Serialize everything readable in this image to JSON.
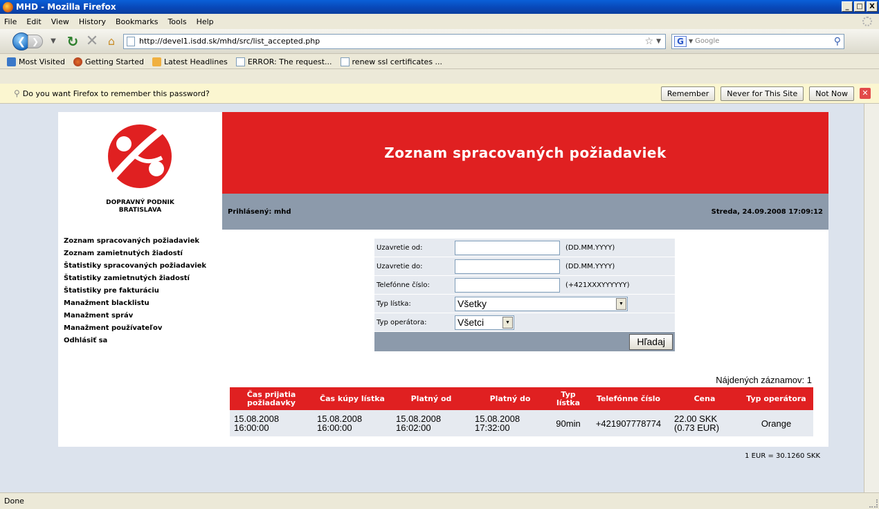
{
  "window": {
    "title": "MHD - Mozilla Firefox",
    "buttons": [
      "_",
      "□",
      "X"
    ]
  },
  "menu": [
    "File",
    "Edit",
    "View",
    "History",
    "Bookmarks",
    "Tools",
    "Help"
  ],
  "toolbar": {
    "url": "http://devel1.isdd.sk/mhd/src/list_accepted.php",
    "search_placeholder": "Google"
  },
  "bookmarks": [
    {
      "label": "Most Visited",
      "icon": "most-visited-icon"
    },
    {
      "label": "Getting Started",
      "icon": "firefox-icon"
    },
    {
      "label": "Latest Headlines",
      "icon": "rss-feed-icon"
    },
    {
      "label": "ERROR: The request...",
      "icon": "page-icon"
    },
    {
      "label": "renew ssl certificates ...",
      "icon": "page-icon"
    }
  ],
  "notification": {
    "message": "Do you want Firefox to remember this password?",
    "remember": "Remember",
    "never": "Never for This Site",
    "not_now": "Not Now"
  },
  "site": {
    "org_line1": "DOPRAVNÝ PODNIK",
    "org_line2": "BRATISLAVA",
    "heading": "Zoznam spracovaných požiadaviek",
    "logged_in": "Prihlásený: mhd",
    "datetime": "Streda, 24.09.2008 17:09:12",
    "brand_color": "#e02021"
  },
  "nav": [
    "Zoznam spracovaných požiadaviek",
    "Zoznam zamietnutých žiadostí",
    "Štatistiky spracovaných požiadaviek",
    "Štatistiky zamietnutých žiadostí",
    "Štatistiky pre fakturáciu",
    "Manažment blacklistu",
    "Manažment správ",
    "Manažment používateľov",
    "Odhlásiť sa"
  ],
  "form": {
    "closed_from_label": "Uzavretie od:",
    "closed_from_hint": "(DD.MM.YYYY)",
    "closed_from_value": "",
    "closed_to_label": "Uzavretie do:",
    "closed_to_hint": "(DD.MM.YYYY)",
    "closed_to_value": "",
    "phone_label": "Telefónne číslo:",
    "phone_hint": "(+421XXXYYYYYY)",
    "phone_value": "",
    "ticket_type_label": "Typ lístka:",
    "ticket_type_value": "Všetky",
    "operator_label": "Typ operátora:",
    "operator_value": "Všetci",
    "search_button": "Hľadaj"
  },
  "results": {
    "count_text": "Nájdených záznamov: 1",
    "headers": [
      "Čas prijatia požiadavky",
      "Čas kúpy lístka",
      "Platný od",
      "Platný do",
      "Typ lístka",
      "Telefónne číslo",
      "Cena",
      "Typ operátora"
    ],
    "rows": [
      {
        "received": [
          "15.08.2008",
          "16:00:00"
        ],
        "purchased": [
          "15.08.2008",
          "16:00:00"
        ],
        "valid_from": [
          "15.08.2008",
          "16:02:00"
        ],
        "valid_to": [
          "15.08.2008",
          "17:32:00"
        ],
        "ticket_type": "90min",
        "phone": "+421907778774",
        "price": [
          "22.00 SKK",
          "(0.73 EUR)"
        ],
        "operator": "Orange"
      }
    ],
    "rate_note": "1 EUR = 30.1260 SKK"
  },
  "status": "Done"
}
